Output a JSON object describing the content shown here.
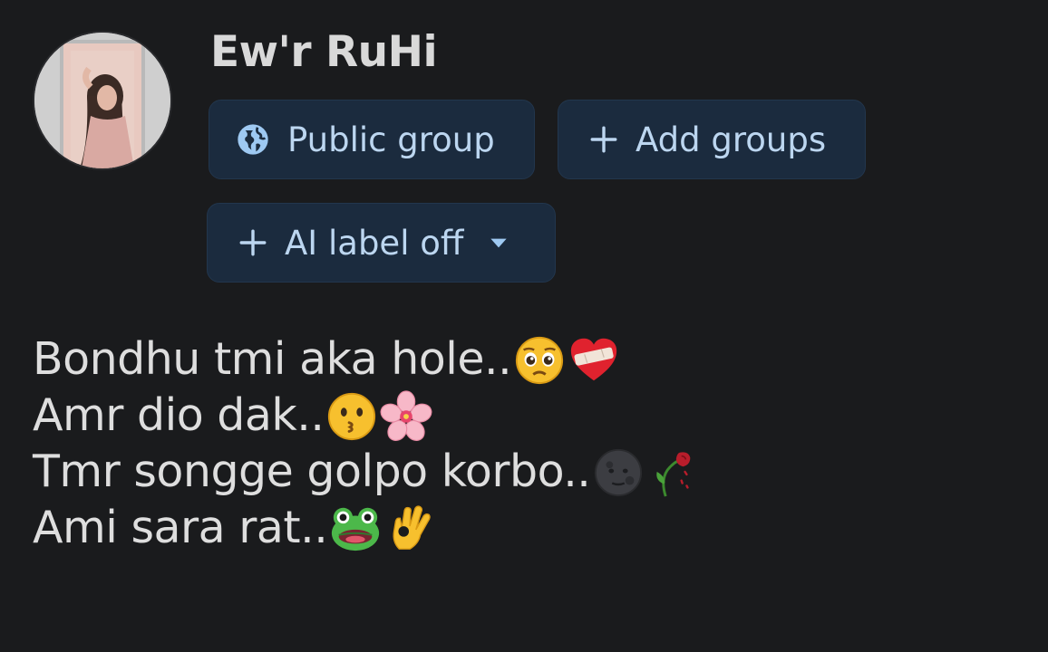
{
  "profile": {
    "name": "Ew'r RuHi",
    "avatar_icon": "profile-photo"
  },
  "chips": {
    "public_group": {
      "label": "Public group",
      "icon": "globe-icon"
    },
    "add_groups": {
      "label": "Add groups",
      "icon": "plus-icon"
    },
    "ai_label": {
      "label": "AI label off",
      "icon": "plus-icon",
      "trailing_icon": "caret-down-icon"
    }
  },
  "post": {
    "lines": [
      {
        "text": "Bondhu tmi aka hole..",
        "emojis": [
          "pleading-face-emoji",
          "mending-heart-emoji"
        ]
      },
      {
        "text": "Amr dio dak..",
        "emojis": [
          "kissing-face-emoji",
          "cherry-blossom-emoji"
        ]
      },
      {
        "text": "Tmr songge golpo korbo..",
        "emojis": [
          "new-moon-face-emoji",
          "wilted-rose-emoji"
        ]
      },
      {
        "text": "Ami sara rat..",
        "emojis": [
          "frog-emoji",
          "ok-hand-emoji"
        ]
      }
    ]
  },
  "colors": {
    "background": "#1a1b1d",
    "chip_background": "#1b2b3e",
    "chip_text": "#bcd6f0",
    "text": "#dedede"
  }
}
